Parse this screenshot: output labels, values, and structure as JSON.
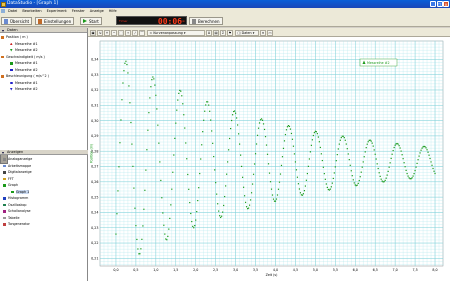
{
  "title": "DataStudio - [Graph 1]",
  "window_buttons": [
    "_",
    "□",
    "×"
  ],
  "menu": [
    "Datei",
    "Bearbeiten",
    "Experiment",
    "Fenster",
    "Anzeige",
    "Hilfe"
  ],
  "toolbar": {
    "overview_label": "Übersicht",
    "settings_label": "Einstellungen",
    "start_label": "Start",
    "clock_label": "Timer",
    "clock_value": "00:06",
    "clock_unit": "min",
    "calculate_label": "Berechnen"
  },
  "data_panel": {
    "header": "Daten",
    "groups": [
      {
        "name": "Position ( m )",
        "items": [
          "Messreihe #1",
          "Messreihe #2"
        ]
      },
      {
        "name": "Geschwindigkeit ( m/s )",
        "items": [
          "Messreihe #1",
          "Messreihe #2"
        ]
      },
      {
        "name": "Beschleunigung ( m/s^2 )",
        "items": [
          "Messreihe #1",
          "Messreihe #2"
        ]
      }
    ]
  },
  "display_panel": {
    "header": "Anzeigen",
    "items": [
      "Analoganzeige",
      "Arbeitsmappe",
      "Digitalanzeige",
      "FFT",
      "Graph",
      "Graph 1",
      "Histogramm",
      "Oszilloskop",
      "Schallanalyse",
      "Tabelle",
      "Tongenerator"
    ]
  },
  "graph_toolbar": {
    "scale_label": "Kurvenanpassung",
    "data_label": "Daten"
  },
  "colors": {
    "accent": "#1a46b8",
    "series": "#1a9a1a",
    "grid": "#b0e8ec"
  },
  "chart_data": {
    "type": "scatter",
    "ylabel": "Position (m)",
    "xlabel": "Zeit (s)",
    "ylim": [
      0.205,
      0.352
    ],
    "xlim": [
      -0.4,
      8.2
    ],
    "x_ticks": [
      "0,0",
      "0,5",
      "1,0",
      "1,5",
      "2,0",
      "2,5",
      "3,0",
      "3,5",
      "4,0",
      "4,5",
      "5,0",
      "5,5",
      "6,0",
      "6,5",
      "7,0",
      "7,5",
      "8,0"
    ],
    "y_ticks": [
      "0,21",
      "0,22",
      "0,23",
      "0,24",
      "0,25",
      "0,26",
      "0,27",
      "0,28",
      "0,29",
      "0,30",
      "0,31",
      "0,32",
      "0,33",
      "0,34"
    ],
    "legend": "Messreihe #2",
    "series": [
      {
        "name": "Messreihe #2",
        "equilibrium": 0.273,
        "amplitude0": 0.07,
        "decay_per_s": 0.25,
        "period_s": 0.68,
        "x_start": 0.0,
        "x_end": 8.0,
        "first_peak_x": 0.25
      }
    ]
  }
}
